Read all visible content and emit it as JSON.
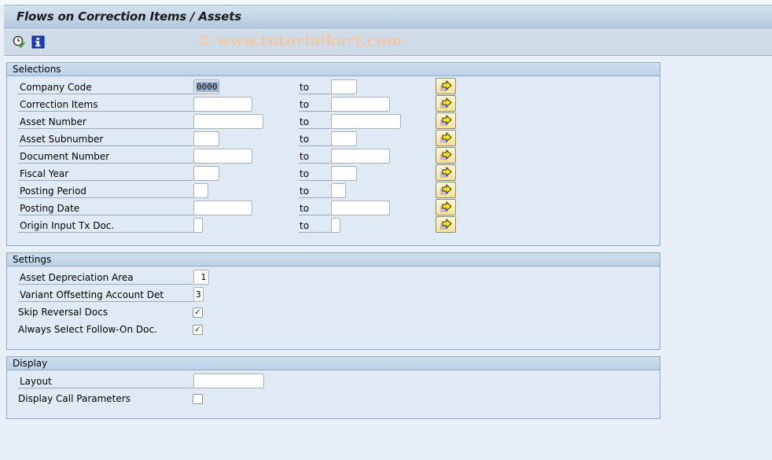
{
  "window": {
    "title": "Flows on Correction Items / Assets"
  },
  "toolbar": {
    "icons": [
      "execute-clock-icon",
      "info-icon"
    ],
    "watermark": "© www.tutorialkart.com"
  },
  "selections": {
    "title": "Selections",
    "to_label": "to",
    "rows": [
      {
        "label": "Company Code",
        "from": "0000",
        "to": ""
      },
      {
        "label": "Correction Items",
        "from": "",
        "to": ""
      },
      {
        "label": "Asset Number",
        "from": "",
        "to": ""
      },
      {
        "label": "Asset Subnumber",
        "from": "",
        "to": ""
      },
      {
        "label": "Document Number",
        "from": "",
        "to": ""
      },
      {
        "label": "Fiscal Year",
        "from": "",
        "to": ""
      },
      {
        "label": "Posting Period",
        "from": "",
        "to": ""
      },
      {
        "label": "Posting Date",
        "from": "",
        "to": ""
      },
      {
        "label": "Origin Input Tx Doc.",
        "from": "",
        "to": ""
      }
    ]
  },
  "settings": {
    "title": "Settings",
    "asset_depreciation_area": {
      "label": "Asset Depreciation Area",
      "value": "1"
    },
    "variant_offsetting": {
      "label": "Variant Offsetting Account Det",
      "value": "3"
    },
    "skip_reversal": {
      "label": "Skip Reversal Docs",
      "checked": true,
      "mark": "✓"
    },
    "always_select": {
      "label": "Always Select Follow-On Doc.",
      "checked": true,
      "mark": "✓"
    }
  },
  "display": {
    "title": "Display",
    "layout": {
      "label": "Layout",
      "value": ""
    },
    "call_params": {
      "label": "Display Call Parameters",
      "checked": false,
      "mark": ""
    }
  }
}
